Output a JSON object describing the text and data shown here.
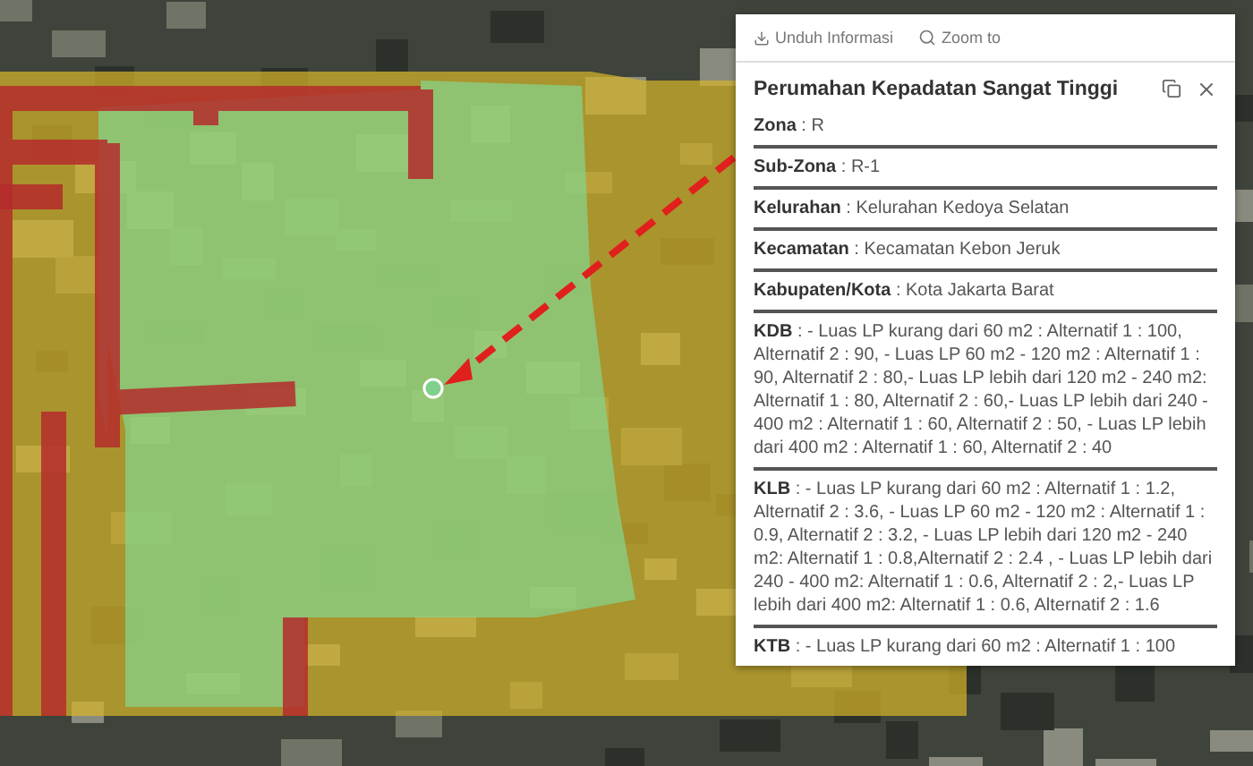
{
  "popup": {
    "actions": [
      {
        "kind": "download",
        "label": "Unduh Informasi"
      },
      {
        "kind": "zoom",
        "label": "Zoom to"
      }
    ],
    "title": "Perumahan Kepadatan Sangat Tinggi",
    "fields": [
      "**Zona** : R",
      "**Sub-Zona** : R-1",
      "**Kelurahan** : Kelurahan Kedoya Selatan",
      "**Kecamatan** : Kecamatan Kebon Jeruk",
      "**Kabupaten/Kota** : Kota Jakarta Barat",
      "**KDB** : - Luas LP kurang dari 60 m2 : Alternatif 1 : 100, Alternatif 2 : 90, - Luas LP 60 m2 - 120 m2 : Alternatif 1 : 90, Alternatif 2 : 80,- Luas LP lebih dari 120 m2 - 240 m2: Alternatif 1 : 80, Alternatif 2 : 60,- Luas LP lebih dari 240 - 400 m2 : Alternatif 1 : 60, Alternatif 2 : 50, - Luas LP lebih dari 400 m2 : Alternatif 1 : 60, Alternatif 2 : 40",
      "**KLB** : - Luas LP kurang dari 60 m2 : Alternatif 1 : 1.2, Alternatif 2 : 3.6, - Luas LP 60 m2 - 120 m2 : Alternatif 1 : 0.9, Alternatif 2 : 3.2, - Luas LP lebih dari 120 m2 - 240 m2: Alternatif 1 : 0.8,Alternatif 2 : 2.4 , - Luas LP lebih dari 240 - 400 m2: Alternatif 1 : 0.6, Alternatif 2 : 2,- Luas LP lebih dari 400 m2: Alternatif 1 : 0.6, Alternatif 2 : 1.6",
      "**KTB** : - Luas LP kurang dari 60 m2 : Alternatif 1 : 100"
    ]
  }
}
